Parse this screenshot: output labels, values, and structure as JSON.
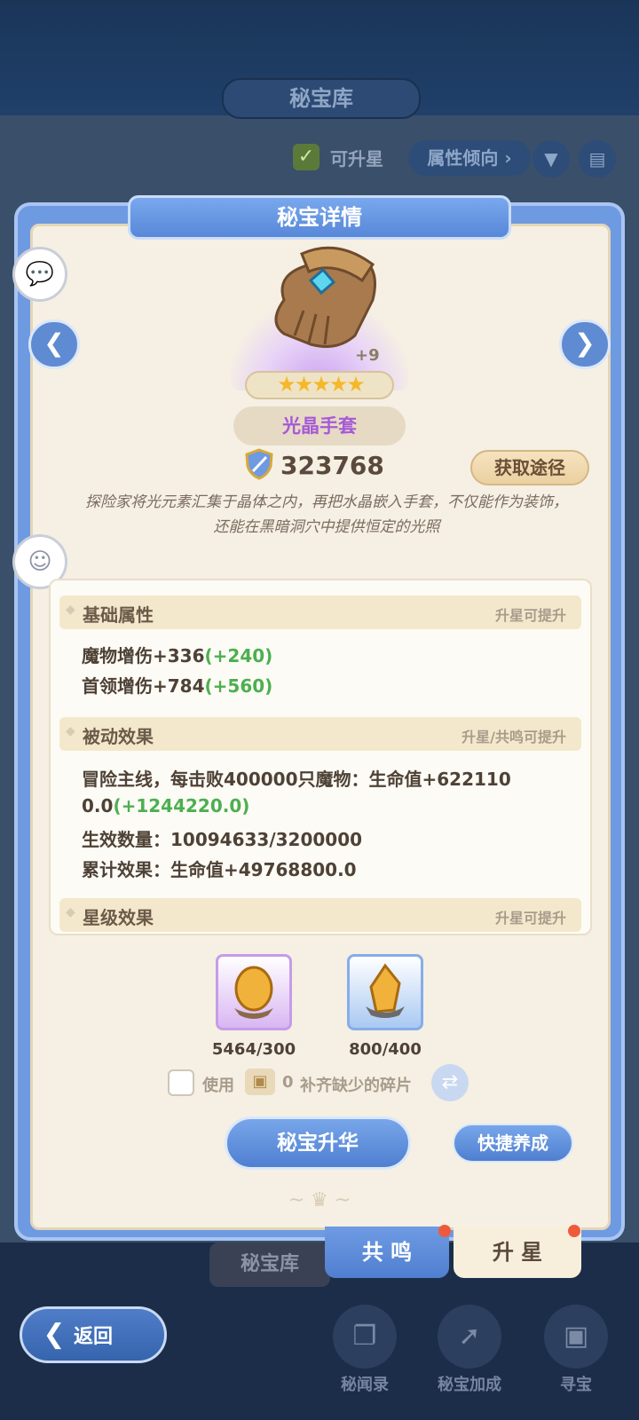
{
  "background": {
    "title": "秘宝库",
    "upgradable_label": "可升星",
    "attribute_filter_label": "属性倾向",
    "bottom_tab_label": "秘宝库",
    "nav": [
      {
        "label": "秘闻录",
        "icon": "book-icon"
      },
      {
        "label": "秘宝加成",
        "icon": "arrow-up-icon"
      },
      {
        "label": "寻宝",
        "icon": "chest-icon"
      }
    ],
    "back_label": "返回"
  },
  "dialog": {
    "title": "秘宝详情",
    "item": {
      "name": "光晶手套",
      "enhance_level": "+9",
      "star_count": 5,
      "power": "323768",
      "source_button": "获取途径",
      "description": "探险家将光元素汇集于晶体之内，再把水晶嵌入手套，不仅能作为装饰，还能在黑暗洞穴中提供恒定的光照"
    },
    "basic": {
      "title": "基础属性",
      "note": "升星可提升",
      "lines": [
        {
          "text": "魔物增伤+336",
          "bonus": "(+240)"
        },
        {
          "text": "首领增伤+784",
          "bonus": "(+560)"
        }
      ]
    },
    "passive": {
      "title": "被动效果",
      "note": "升星/共鸣可提升",
      "line1": "冒险主线，每击败400000只魔物：生命值+622110",
      "line2": "0.0",
      "line2_bonus": "(+1244220.0)",
      "count": "生效数量：10094633/3200000",
      "total": "累计效果：生命值+49768800.0"
    },
    "star_effect": {
      "title": "星级效果",
      "note": "升星可提升"
    },
    "materials": [
      {
        "count": "5464/300",
        "color": "#c69ce8"
      },
      {
        "count": "800/400",
        "color": "#86acea"
      }
    ],
    "use_label": "使用",
    "use_count": "0",
    "use_suffix": "补齐缺少的碎片",
    "main_button": "秘宝升华",
    "quick_button": "快捷养成",
    "tabs": [
      {
        "label": "共 鸣",
        "active": false
      },
      {
        "label": "升 星",
        "active": true
      }
    ]
  },
  "colors": {
    "accent_blue": "#5f8bd3",
    "purple_name": "#a65ad6",
    "bonus_green": "#4caf50",
    "badge_red": "#f05a3c"
  }
}
